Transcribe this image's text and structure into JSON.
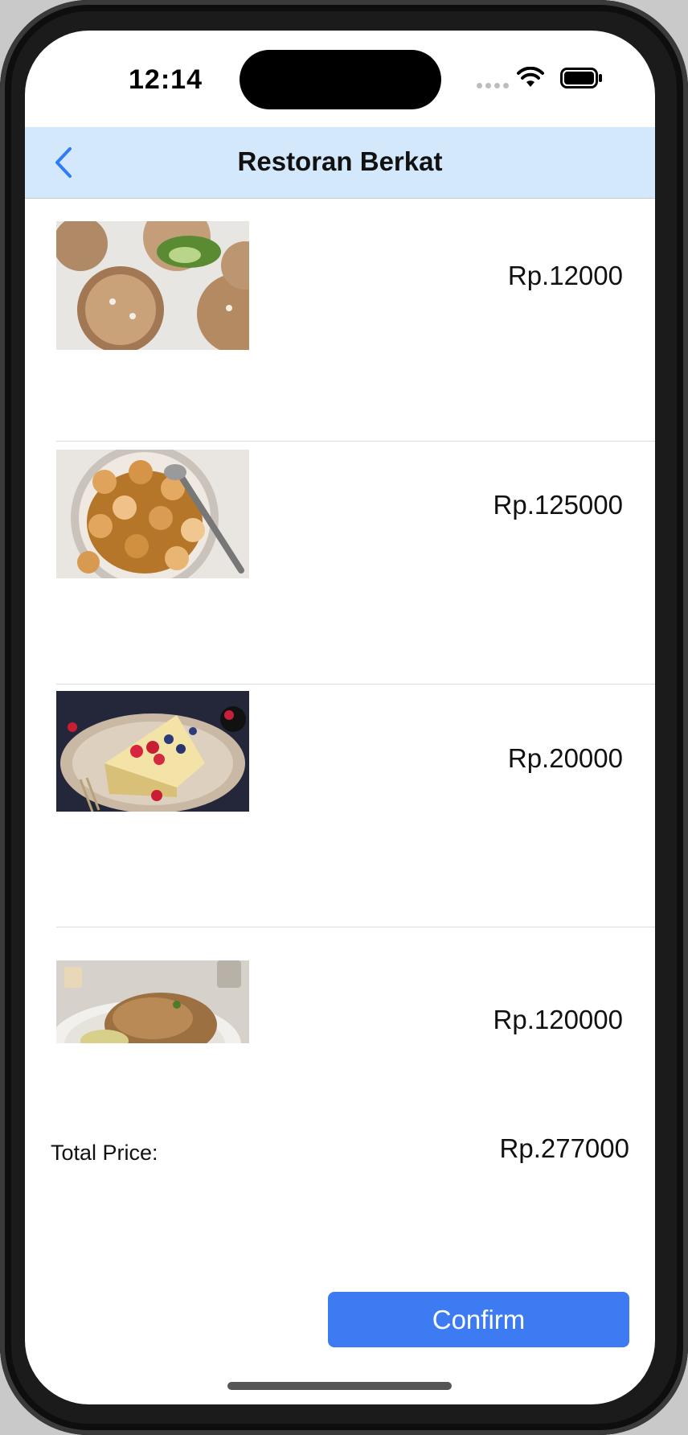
{
  "status_bar": {
    "time": "12:14",
    "icons": [
      "signal-dots-icon",
      "wifi-icon",
      "battery-icon"
    ]
  },
  "nav": {
    "title": "Restoran Berkat",
    "back_icon": "chevron-left-icon",
    "back_color": "#2f7cf6",
    "background": "#d4e8fb"
  },
  "items": [
    {
      "image": "stuffed-meatball-appetizer-photo",
      "price": "Rp.12000"
    },
    {
      "image": "seared-scallops-plate-photo",
      "price": "Rp.125000"
    },
    {
      "image": "berry-cheesecake-slice-photo",
      "price": "Rp.20000"
    },
    {
      "image": "roast-chicken-plate-photo",
      "price": "Rp.120000"
    }
  ],
  "total": {
    "label": "Total Price:",
    "value": "Rp.277000"
  },
  "confirm_button": {
    "label": "Confirm",
    "color": "#3d7bf2"
  }
}
